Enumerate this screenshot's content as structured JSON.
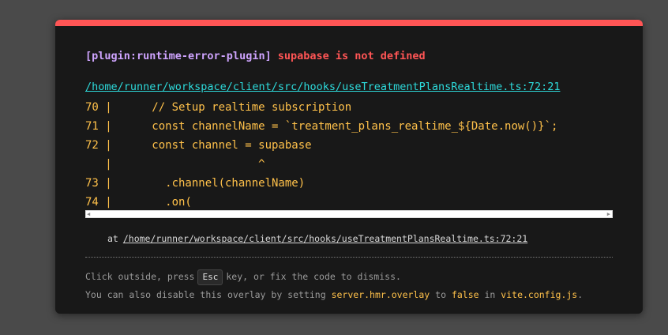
{
  "overlay": {
    "plugin": "[plugin:runtime-error-plugin]",
    "message": "supabase is not defined",
    "file": "/home/runner/workspace/client/src/hooks/useTreatmentPlansRealtime.ts:72:21",
    "code_frame": [
      "70 |      // Setup realtime subscription",
      "71 |      const channelName = `treatment_plans_realtime_${Date.now()}`;",
      "72 |      const channel = supabase",
      "   |                      ^",
      "73 |        .channel(channelName)",
      "74 |        .on("
    ],
    "scroll_left": "◀",
    "scroll_right": "▶",
    "stack_prefix": "at",
    "stack_file": "/home/runner/workspace/client/src/hooks/useTreatmentPlansRealtime.ts:72:21",
    "tip1_before": "Click outside, press",
    "tip1_key": "Esc",
    "tip1_after": "key, or fix the code to dismiss.",
    "tip2_before": "You can also disable this overlay by setting",
    "tip2_setting": "server.hmr.overlay",
    "tip2_mid": "to",
    "tip2_value": "false",
    "tip2_in": "in",
    "tip2_file": "vite.config.js",
    "tip2_end": "."
  },
  "colors": {
    "accent_red": "#ff5555",
    "plugin_purple": "#cfa4ff",
    "link_cyan": "#2dd9da",
    "code_yellow": "#ffc14a"
  }
}
